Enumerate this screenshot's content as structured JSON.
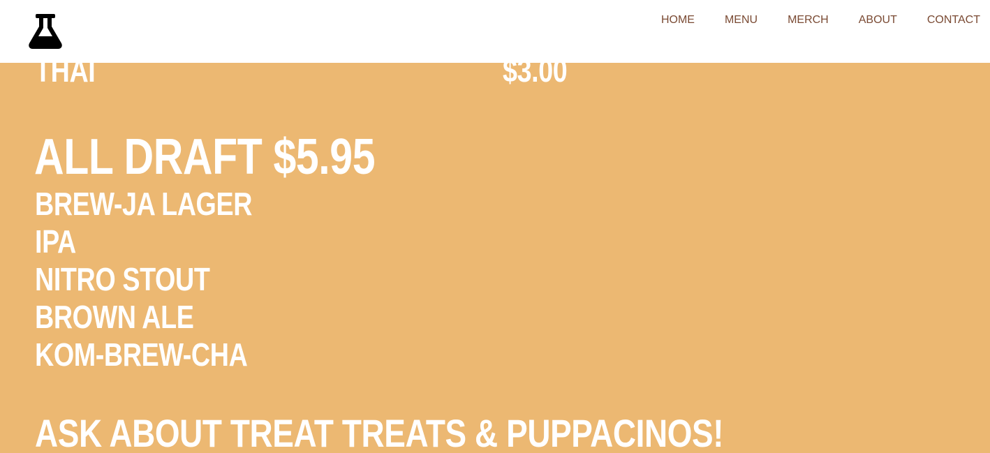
{
  "header": {
    "logo_icon": "flask-icon",
    "nav": [
      {
        "label": "HOME"
      },
      {
        "label": "MENU"
      },
      {
        "label": "MERCH"
      },
      {
        "label": "ABOUT"
      },
      {
        "label": "CONTACT"
      }
    ]
  },
  "menu": {
    "previous_item": {
      "name": "THAI",
      "price": "$3.00"
    },
    "draft": {
      "heading": "ALL DRAFT $5.95",
      "items": [
        "BREW-JA LAGER",
        "IPA",
        "NITRO STOUT",
        "BROWN ALE",
        "KOM-BREW-CHA"
      ]
    },
    "treats_line": "ASK ABOUT TREAT TREATS & PUPPACINOS!"
  },
  "colors": {
    "menu_background": "#ecb872",
    "menu_text": "#ffffff",
    "nav_text": "#7a4a33",
    "header_background": "#ffffff"
  }
}
